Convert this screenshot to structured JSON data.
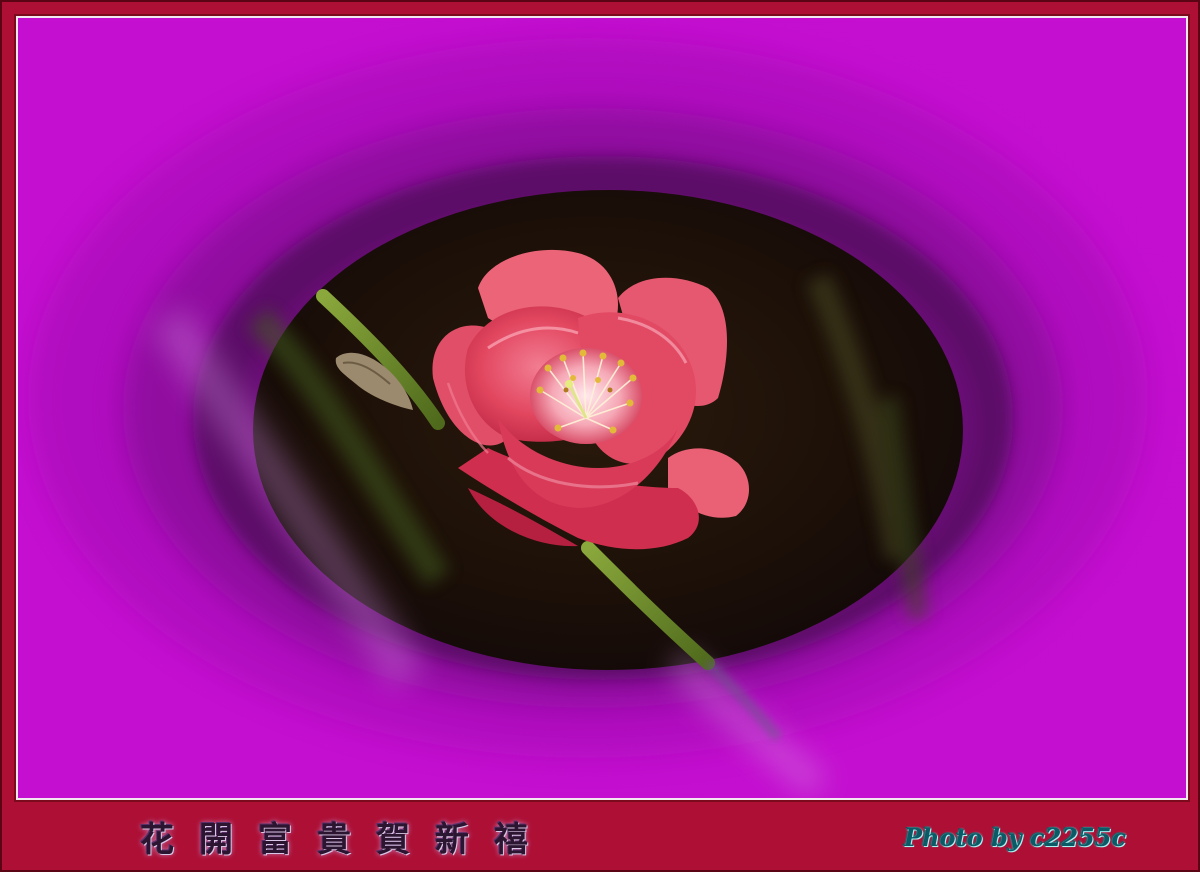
{
  "caption": {
    "title": "花開富貴賀新禧",
    "credit": "Photo by c2255c"
  },
  "colors": {
    "background_magenta": "#bf0ccb",
    "frame_crimson": "#ad0f35",
    "vignette_dark": "#1f0d0b",
    "blossom_pink": "#e8475f",
    "stem_green": "#6b8a2a",
    "stamen_yellow": "#e7c53b"
  },
  "subject": {
    "icon": "peach-blossom-icon"
  }
}
